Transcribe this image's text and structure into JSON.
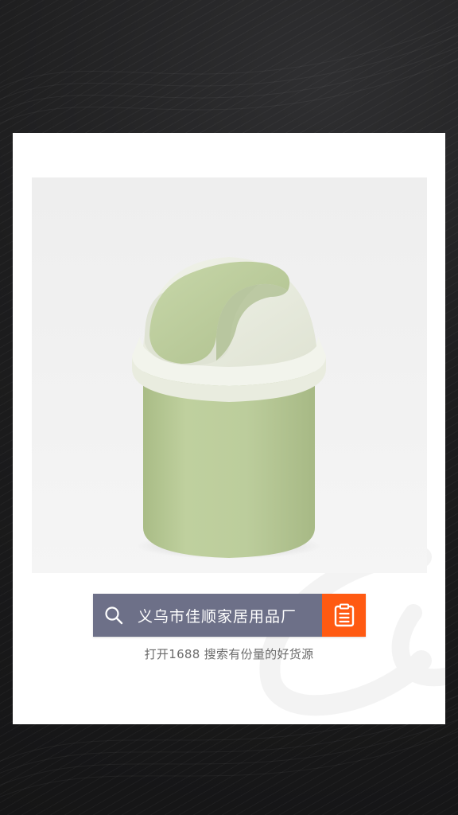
{
  "search": {
    "query_text": "义乌市佳顺家居用品厂",
    "icon": "search-icon",
    "button_icon": "clipboard-icon"
  },
  "caption": "打开1688 搜索有份量的好货源",
  "product_image": {
    "subject": "trash-can-image"
  },
  "colors": {
    "search_field": "#6d7088",
    "search_button": "#ff5a12",
    "bin_green": "#b9cb98",
    "bin_lid_cream": "#ecefe2",
    "card_background": "#ffffff",
    "page_background": "#1b1b1c"
  }
}
